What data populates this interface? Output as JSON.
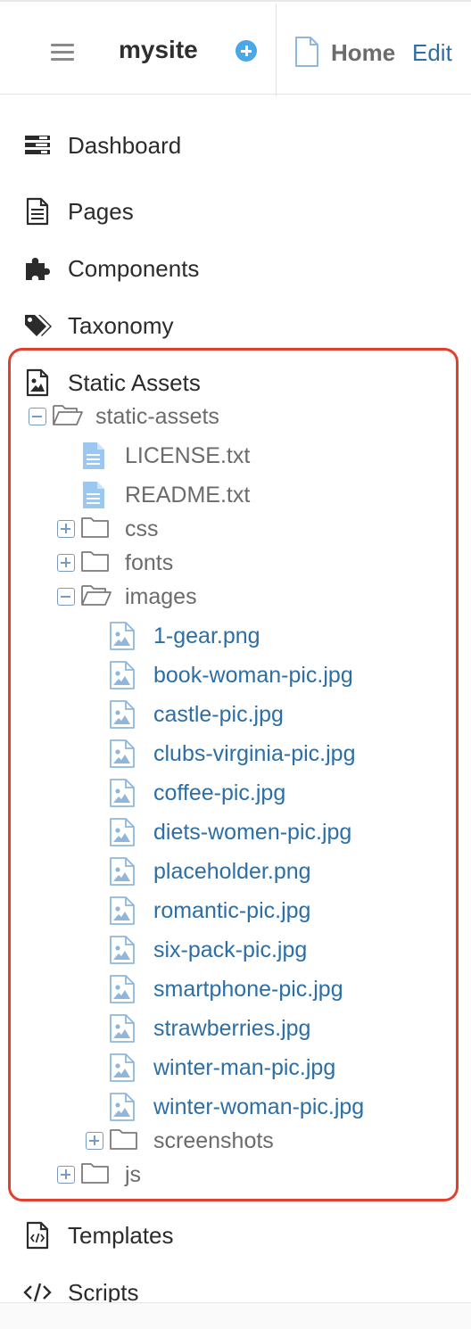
{
  "header": {
    "site_title": "mysite",
    "breadcrumb_page": "Home",
    "edit_label": "Edit",
    "icons": {
      "menu": "hamburger-icon",
      "add": "plus-circle-icon",
      "page": "page-icon"
    },
    "accent_color": "#4aa8e8"
  },
  "nav": {
    "dashboard": {
      "label": "Dashboard",
      "icon": "dashboard-icon"
    },
    "pages": {
      "label": "Pages",
      "icon": "document-icon"
    },
    "components": {
      "label": "Components",
      "icon": "puzzle-icon"
    },
    "taxonomy": {
      "label": "Taxonomy",
      "icon": "tags-icon"
    },
    "static_assets": {
      "label": "Static Assets",
      "icon": "image-file-icon"
    },
    "templates": {
      "label": "Templates",
      "icon": "code-file-icon"
    },
    "scripts": {
      "label": "Scripts",
      "icon": "code-icon"
    }
  },
  "tree": {
    "root": {
      "label": "static-assets",
      "expanded": true
    },
    "license": "LICENSE.txt",
    "readme": "README.txt",
    "css": {
      "label": "css",
      "expanded": false
    },
    "fonts": {
      "label": "fonts",
      "expanded": false
    },
    "images": {
      "label": "images",
      "expanded": true,
      "files": [
        "1-gear.png",
        "book-woman-pic.jpg",
        "castle-pic.jpg",
        "clubs-virginia-pic.jpg",
        "coffee-pic.jpg",
        "diets-women-pic.jpg",
        "placeholder.png",
        "romantic-pic.jpg",
        "six-pack-pic.jpg",
        "smartphone-pic.jpg",
        "strawberries.jpg",
        "winter-man-pic.jpg",
        "winter-woman-pic.jpg"
      ]
    },
    "screenshots": {
      "label": "screenshots",
      "expanded": false
    },
    "js": {
      "label": "js",
      "expanded": false
    }
  },
  "highlight_color": "#e0412f",
  "link_color": "#2c6ea5"
}
